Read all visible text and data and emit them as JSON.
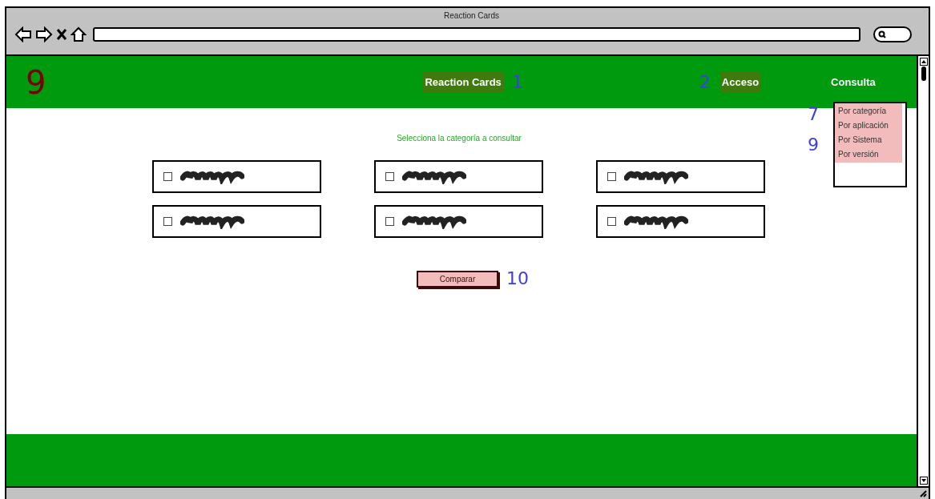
{
  "browser": {
    "title": "Reaction Cards"
  },
  "header": {
    "marker": "9",
    "brand": "Reaction Cards",
    "brand_note": "1",
    "access_note": "2",
    "access": "Acceso",
    "menu": "Consulta"
  },
  "dropdown": {
    "items": [
      {
        "label": "Por categoría"
      },
      {
        "label": "Por aplicación"
      },
      {
        "label": "Por Sistema"
      },
      {
        "label": "Por versión"
      }
    ],
    "notes": [
      "7",
      "9"
    ]
  },
  "content": {
    "prompt": "Selecciona la categoría a consultar",
    "options": [
      {
        "checked": false
      },
      {
        "checked": false
      },
      {
        "checked": false
      },
      {
        "checked": false
      },
      {
        "checked": false
      },
      {
        "checked": false
      }
    ],
    "button": "Comparar",
    "button_note": "10"
  }
}
